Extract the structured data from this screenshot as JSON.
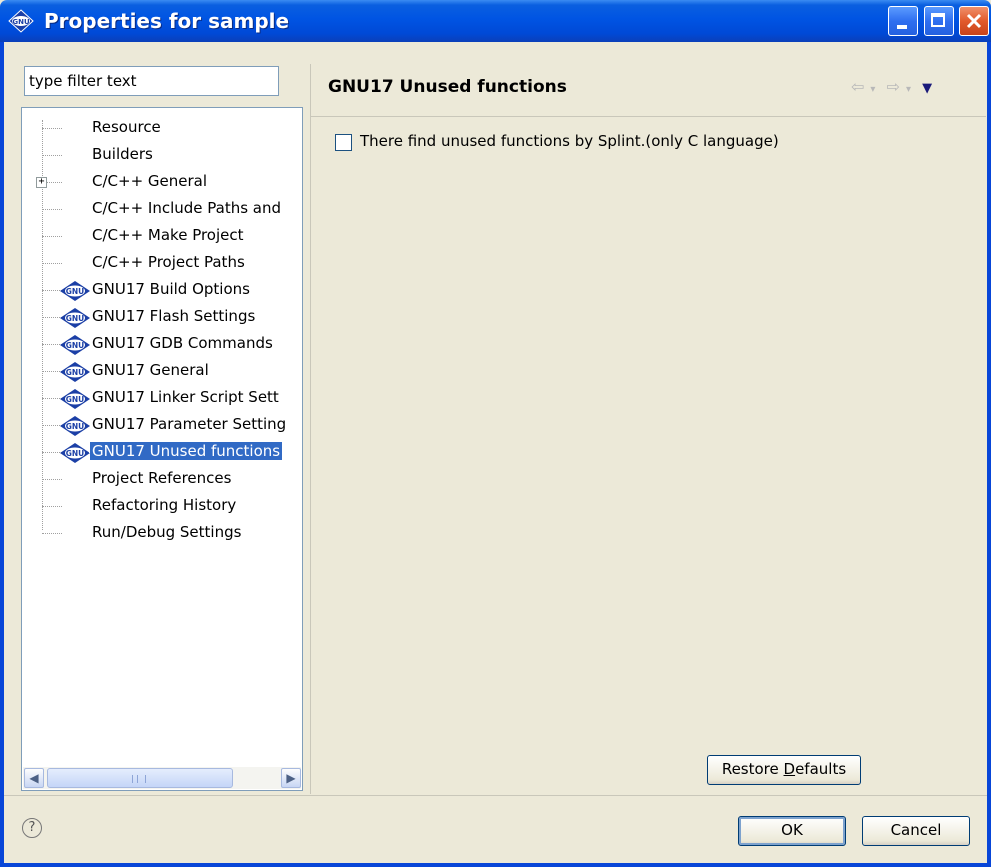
{
  "window": {
    "title": "Properties for sample"
  },
  "filter": {
    "placeholder": "type filter text",
    "value": "type filter text"
  },
  "tree": {
    "items": [
      {
        "label": "Resource",
        "icon": "none"
      },
      {
        "label": "Builders",
        "icon": "none"
      },
      {
        "label": "C/C++ General",
        "icon": "none",
        "expandable": true
      },
      {
        "label": "C/C++ Include Paths and",
        "icon": "none"
      },
      {
        "label": "C/C++ Make Project",
        "icon": "none"
      },
      {
        "label": "C/C++ Project Paths",
        "icon": "none"
      },
      {
        "label": "GNU17 Build Options",
        "icon": "gnu-icon"
      },
      {
        "label": "GNU17 Flash Settings",
        "icon": "gnu-icon"
      },
      {
        "label": "GNU17 GDB Commands",
        "icon": "gnu-icon"
      },
      {
        "label": "GNU17 General",
        "icon": "gnu-icon"
      },
      {
        "label": "GNU17 Linker Script Sett",
        "icon": "gnu-icon"
      },
      {
        "label": "GNU17 Parameter Setting",
        "icon": "gnu-icon"
      },
      {
        "label": "GNU17 Unused functions",
        "icon": "gnu-icon",
        "selected": true
      },
      {
        "label": "Project References",
        "icon": "none"
      },
      {
        "label": "Refactoring History",
        "icon": "none"
      },
      {
        "label": "Run/Debug Settings",
        "icon": "none"
      }
    ]
  },
  "page": {
    "title": "GNU17 Unused functions",
    "checkbox_label": "There find unused functions by Splint.(only C language)",
    "checkbox_checked": false,
    "restore_defaults_label": "Restore Defaults"
  },
  "footer": {
    "ok_label": "OK",
    "cancel_label": "Cancel"
  },
  "colors": {
    "titlebar": "#0054e3",
    "selection": "#316ac5"
  }
}
